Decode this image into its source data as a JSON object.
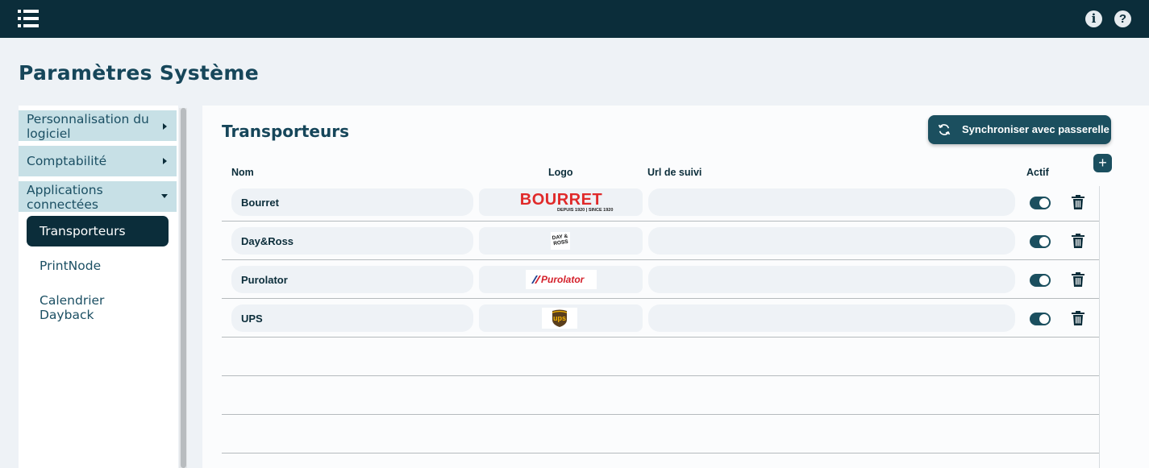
{
  "header": {
    "menu_icon": "menu-list-icon",
    "info_icon": "info-icon",
    "info_glyph": "i",
    "help_icon": "help-icon",
    "help_glyph": "?"
  },
  "page": {
    "title": "Paramètres Système"
  },
  "sidebar": {
    "sections": [
      {
        "label": "Personnalisation du logiciel",
        "expanded": false
      },
      {
        "label": "Comptabilité",
        "expanded": false
      },
      {
        "label": "Applications connectées",
        "expanded": true
      }
    ],
    "subitems": [
      {
        "label": "Transporteurs",
        "active": true
      },
      {
        "label": "PrintNode",
        "active": false
      },
      {
        "label": "Calendrier Dayback",
        "active": false
      }
    ]
  },
  "panel": {
    "title": "Transporteurs",
    "sync_button": "Synchroniser avec passerelle",
    "add_button": "+",
    "columns": {
      "name": "Nom",
      "logo": "Logo",
      "url": "Url de suivi",
      "active": "Actif"
    },
    "carriers": [
      {
        "name": "Bourret",
        "url": "",
        "active": true,
        "logo": {
          "text": "BOURRET",
          "subtext": "DEPUIS 1920 | SINCE 1920",
          "color": "#e02a2a"
        }
      },
      {
        "name": "Day&Ross",
        "url": "",
        "active": true,
        "logo": {
          "text": "DAY & ROSS",
          "color": "#111111"
        }
      },
      {
        "name": "Purolator",
        "url": "",
        "active": true,
        "logo": {
          "text": "Purolator",
          "color": "#d4202a"
        }
      },
      {
        "name": "UPS",
        "url": "",
        "active": true,
        "logo": {
          "text": "ups",
          "color": "#5a3e1b"
        }
      }
    ]
  },
  "colors": {
    "header_bg": "#0b2d3a",
    "accent": "#1b4f5f",
    "sidebar_section_bg": "#c7e0e6",
    "page_bg": "#eef2f6"
  }
}
